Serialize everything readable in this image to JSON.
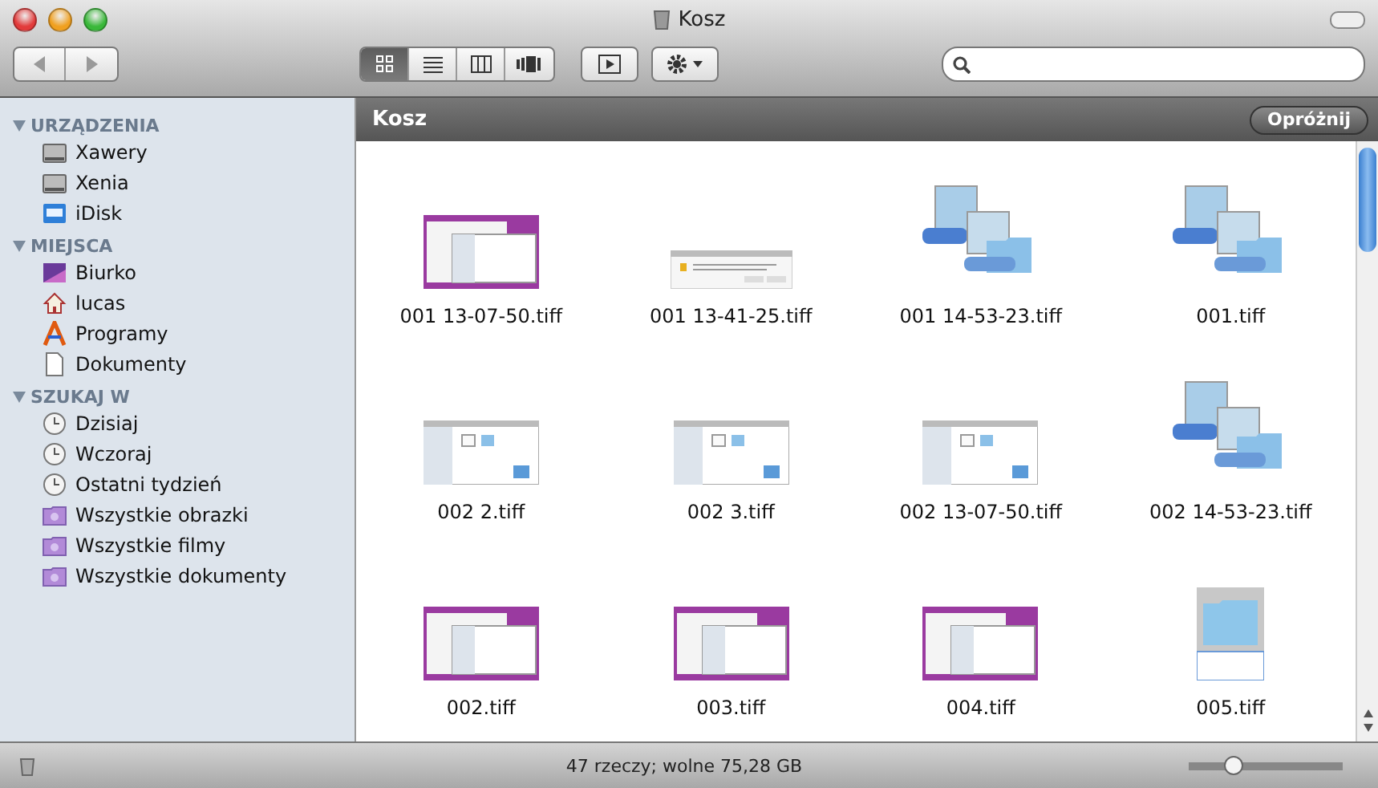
{
  "window": {
    "title": "Kosz"
  },
  "toolbar": {
    "view_buttons": [
      {
        "kind": "icons",
        "selected": true
      },
      {
        "kind": "list",
        "selected": false
      },
      {
        "kind": "columns",
        "selected": false
      },
      {
        "kind": "coverflow",
        "selected": false
      }
    ]
  },
  "sidebar": {
    "sections": [
      {
        "title": "URZĄDZENIA",
        "expanded": true,
        "items": [
          {
            "label": "Xawery",
            "kind": "drive"
          },
          {
            "label": "Xenia",
            "kind": "drive"
          },
          {
            "label": "iDisk",
            "kind": "idisk"
          }
        ]
      },
      {
        "title": "MIEJSCA",
        "expanded": true,
        "items": [
          {
            "label": "Biurko",
            "kind": "desktop"
          },
          {
            "label": "lucas",
            "kind": "home"
          },
          {
            "label": "Programy",
            "kind": "apps"
          },
          {
            "label": "Dokumenty",
            "kind": "document"
          }
        ]
      },
      {
        "title": "SZUKAJ W",
        "expanded": true,
        "items": [
          {
            "label": "Dzisiaj",
            "kind": "clock"
          },
          {
            "label": "Wczoraj",
            "kind": "clock"
          },
          {
            "label": "Ostatni tydzień",
            "kind": "clock"
          },
          {
            "label": "Wszystkie obrazki",
            "kind": "smart"
          },
          {
            "label": "Wszystkie filmy",
            "kind": "smart"
          },
          {
            "label": "Wszystkie dokumenty",
            "kind": "smart"
          }
        ]
      }
    ]
  },
  "path_bar": {
    "title": "Kosz",
    "button": "Opróżnij"
  },
  "files": [
    {
      "name": "001 13-07-50.tiff",
      "kind": "desktop"
    },
    {
      "name": "001 13-41-25.tiff",
      "kind": "dialog"
    },
    {
      "name": "001 14-53-23.tiff",
      "kind": "folders"
    },
    {
      "name": "001.tiff",
      "kind": "folders"
    },
    {
      "name": "002 2.tiff",
      "kind": "window"
    },
    {
      "name": "002 3.tiff",
      "kind": "window"
    },
    {
      "name": "002 13-07-50.tiff",
      "kind": "window"
    },
    {
      "name": "002 14-53-23.tiff",
      "kind": "folders"
    },
    {
      "name": "002.tiff",
      "kind": "desktop"
    },
    {
      "name": "003.tiff",
      "kind": "desktop"
    },
    {
      "name": "004.tiff",
      "kind": "desktop"
    },
    {
      "name": "005.tiff",
      "kind": "folder"
    }
  ],
  "status_bar": {
    "text": "47 rzeczy; wolne 75,28 GB",
    "zoom": {
      "level": 0.25
    }
  }
}
